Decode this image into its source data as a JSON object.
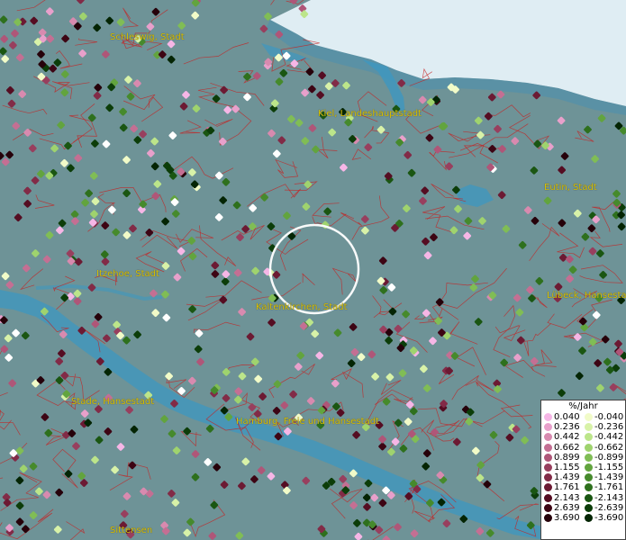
{
  "map": {
    "places": [
      {
        "id": "schleswig",
        "label": "Schleswig, Stadt"
      },
      {
        "id": "kiel",
        "label": "Kiel, Landeshauptstadt"
      },
      {
        "id": "eutin",
        "label": "Eutin, Stadt"
      },
      {
        "id": "itzehoe",
        "label": "Itzehoe, Stadt"
      },
      {
        "id": "kaltenkirchen",
        "label": "Kaltenkirchen, Stadt"
      },
      {
        "id": "luebeck",
        "label": "Lübeck, Hansestadt"
      },
      {
        "id": "stade",
        "label": "Stade, Hansestadt"
      },
      {
        "id": "hamburg",
        "label": "Hamburg, Freie und Hansestadt"
      },
      {
        "id": "sittensen",
        "label": "Sittensen"
      }
    ],
    "colors": {
      "land": "#6e9397",
      "water": "#dfedf3",
      "river": "#3d97c0",
      "boundary": "#c81e1e",
      "label": "#d8c200",
      "selection_ring": "#ffffff"
    }
  },
  "legend": {
    "title": "%/Jahr",
    "positive": [
      {
        "value": "0.040",
        "color": "#f6b6e6"
      },
      {
        "value": "0.236",
        "color": "#e8a0cb"
      },
      {
        "value": "0.442",
        "color": "#d88aaf"
      },
      {
        "value": "0.662",
        "color": "#c46f93"
      },
      {
        "value": "0.899",
        "color": "#af5678"
      },
      {
        "value": "1.155",
        "color": "#983f5e"
      },
      {
        "value": "1.439",
        "color": "#822b47"
      },
      {
        "value": "1.761",
        "color": "#6c1a33"
      },
      {
        "value": "2.143",
        "color": "#550d22"
      },
      {
        "value": "2.639",
        "color": "#3d0514"
      },
      {
        "value": "3.690",
        "color": "#26010a"
      }
    ],
    "negative": [
      {
        "value": "-0.040",
        "color": "#f1fbc8"
      },
      {
        "value": "-0.236",
        "color": "#d8f2a8"
      },
      {
        "value": "-0.442",
        "color": "#bce58a"
      },
      {
        "value": "-0.662",
        "color": "#9fd36e"
      },
      {
        "value": "-0.899",
        "color": "#80bd55"
      },
      {
        "value": "-1.155",
        "color": "#62a43e"
      },
      {
        "value": "-1.439",
        "color": "#468a2c"
      },
      {
        "value": "-1.761",
        "color": "#2e701d"
      },
      {
        "value": "-2.143",
        "color": "#1a5612"
      },
      {
        "value": "-2.639",
        "color": "#0c3d09"
      },
      {
        "value": "-3.690",
        "color": "#042504"
      }
    ]
  }
}
